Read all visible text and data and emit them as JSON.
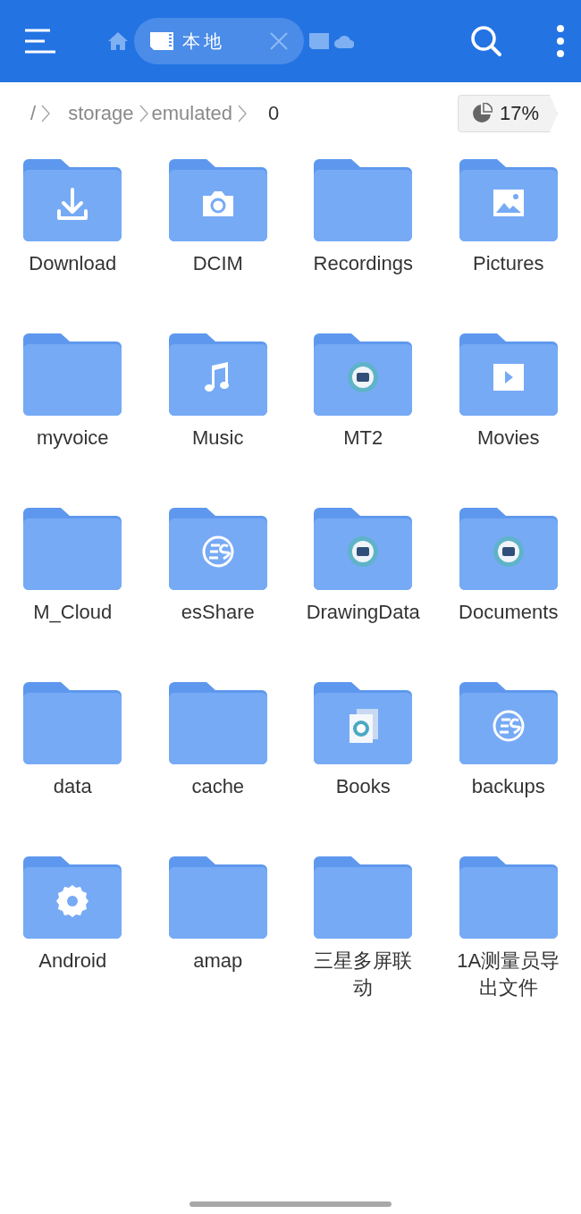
{
  "toolbar": {
    "tabs": [
      {
        "kind": "home",
        "selected": false
      },
      {
        "kind": "local",
        "label": "本地",
        "selected": true
      },
      {
        "kind": "sdcard",
        "selected": false
      },
      {
        "kind": "cloud",
        "selected": false
      }
    ]
  },
  "breadcrumb": [
    {
      "label": "/",
      "selected": false
    },
    {
      "label": "storage",
      "selected": false
    },
    {
      "label": "emulated",
      "selected": false
    },
    {
      "label": "0",
      "selected": true
    }
  ],
  "storage_usage": "17%",
  "folders": [
    {
      "name": "Download",
      "kind": "download"
    },
    {
      "name": "DCIM",
      "kind": "camera"
    },
    {
      "name": "Recordings",
      "kind": "plain"
    },
    {
      "name": "Pictures",
      "kind": "image"
    },
    {
      "name": "myvoice",
      "kind": "plain"
    },
    {
      "name": "Music",
      "kind": "music"
    },
    {
      "name": "MT2",
      "kind": "app"
    },
    {
      "name": "Movies",
      "kind": "play"
    },
    {
      "name": "M_Cloud",
      "kind": "plain"
    },
    {
      "name": "esShare",
      "kind": "es"
    },
    {
      "name": "DrawingData",
      "kind": "app"
    },
    {
      "name": "Documents",
      "kind": "app"
    },
    {
      "name": "data",
      "kind": "plain"
    },
    {
      "name": "cache",
      "kind": "plain"
    },
    {
      "name": "Books",
      "kind": "book"
    },
    {
      "name": "backups",
      "kind": "es"
    },
    {
      "name": "Android",
      "kind": "gear"
    },
    {
      "name": "amap",
      "kind": "plain"
    },
    {
      "name": "三星多屏联动",
      "kind": "plain"
    },
    {
      "name": "1A测量员导出文件",
      "kind": "plain"
    }
  ]
}
